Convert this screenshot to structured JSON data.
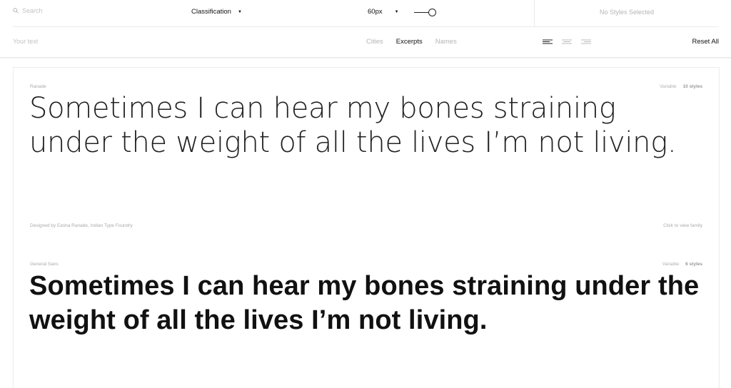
{
  "toolbar": {
    "search_placeholder": "Search",
    "classification_label": "Classification",
    "size_label": "60px",
    "size_slider_fraction": 0.75,
    "styles_status": "No Styles Selected"
  },
  "subbar": {
    "text_placeholder": "Your text",
    "tabs": [
      {
        "label": "Cities",
        "active": false
      },
      {
        "label": "Excerpts",
        "active": true
      },
      {
        "label": "Names",
        "active": false
      }
    ],
    "align_icons": [
      "align-left-icon",
      "align-center-icon",
      "align-right-icon"
    ],
    "reset_label": "Reset All"
  },
  "fonts": [
    {
      "name": "Ranade",
      "type": "Variable",
      "styles": "10 styles",
      "sample": "Sometimes I can hear my bones straining under the weight of all the lives I’m not living.",
      "designer": "Designed by Easha Ranade, Indian Type Foundry",
      "view_label": "Click to view family"
    },
    {
      "name": "General Sans",
      "type": "Variable",
      "styles": "6 styles",
      "sample": "Sometimes I can hear my bones straining under the weight of all the lives I’m not living."
    }
  ],
  "colors": {
    "text": "#111111",
    "muted": "#b4b4b4",
    "divider": "#ececec"
  }
}
